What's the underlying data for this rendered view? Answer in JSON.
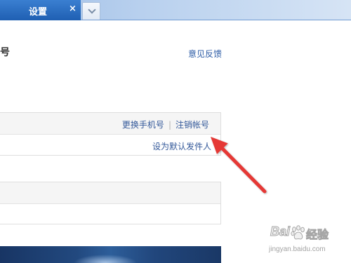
{
  "tab": {
    "label": "设置",
    "close_glyph": "×",
    "close_icon": "close-icon",
    "menu_icon": "chevron-down-icon"
  },
  "header": {
    "title_fragment": "号",
    "feedback_link": "意见反馈"
  },
  "account_box": {
    "actions": [
      {
        "label": "更换手机号"
      },
      {
        "label": "注销帐号"
      }
    ],
    "separator": "|",
    "row_action": "设为默认发件人"
  },
  "watermark": {
    "logo_text": "Bai",
    "logo_icon": "paw-icon",
    "logo_text_cn": "经验",
    "url": "jingyan.baidu.com"
  },
  "colors": {
    "tab_active": "#2466b9",
    "tab_bar": "#b8d0ee",
    "link": "#34599a",
    "annotation_arrow": "#e53935",
    "banner": "#1f4477"
  }
}
